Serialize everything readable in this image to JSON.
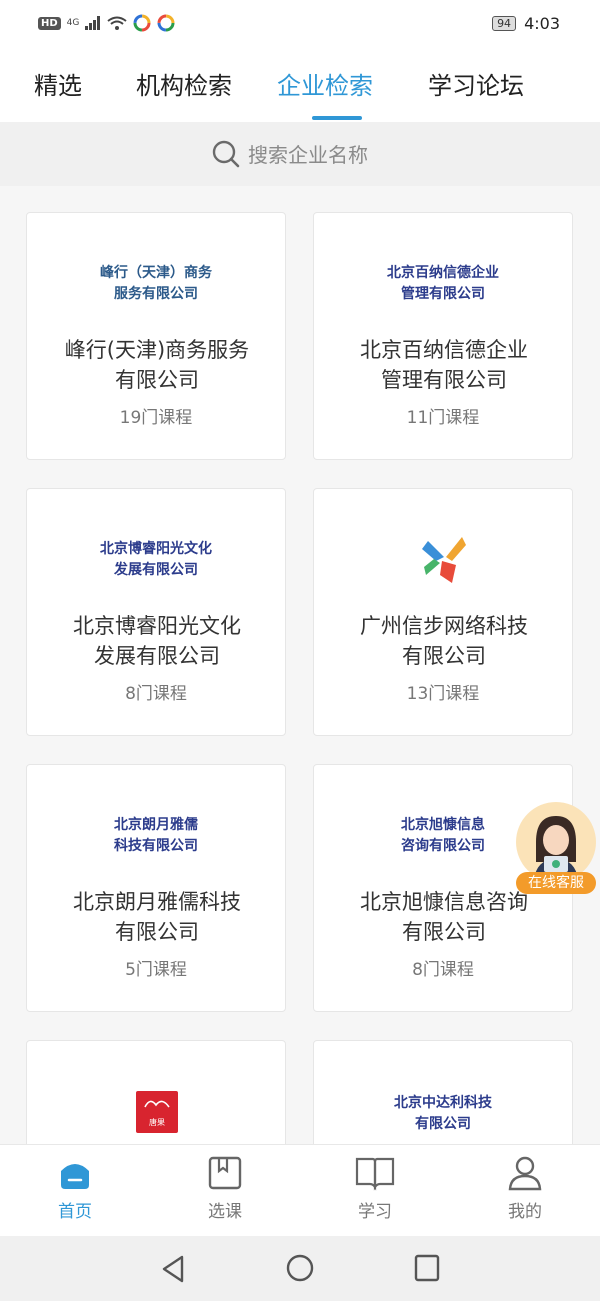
{
  "status_bar": {
    "left": "HD",
    "network": "4G",
    "battery": "94",
    "time": "4:03"
  },
  "tabs": [
    {
      "label": "精选"
    },
    {
      "label": "机构检索"
    },
    {
      "label": "企业检索"
    },
    {
      "label": "学习论坛"
    }
  ],
  "search": {
    "placeholder": "搜索企业名称"
  },
  "companies": [
    {
      "logo_line1": "峰行（天津）商务",
      "logo_line2": "服务有限公司",
      "name_line1": "峰行(天津)商务服务",
      "name_line2": "有限公司",
      "courses": "19门课程"
    },
    {
      "logo_line1": "北京百纳信德企业",
      "logo_line2": "管理有限公司",
      "name_line1": "北京百纳信德企业",
      "name_line2": "管理有限公司",
      "courses": "11门课程"
    },
    {
      "logo_line1": "北京博睿阳光文化",
      "logo_line2": "发展有限公司",
      "name_line1": "北京博睿阳光文化",
      "name_line2": "发展有限公司",
      "courses": "8门课程"
    },
    {
      "name_line1": "广州信步网络科技",
      "name_line2": "有限公司",
      "courses": "13门课程"
    },
    {
      "logo_line1": "北京朗月雅儒",
      "logo_line2": "科技有限公司",
      "name_line1": "北京朗月雅儒科技",
      "name_line2": "有限公司",
      "courses": "5门课程"
    },
    {
      "logo_line1": "北京旭慷信息",
      "logo_line2": "咨询有限公司",
      "name_line1": "北京旭慷信息咨询",
      "name_line2": "有限公司",
      "courses": "8门课程"
    },
    {
      "logo_text": "唐果"
    },
    {
      "logo_line1": "北京中达利科技",
      "logo_line2": "有限公司"
    }
  ],
  "customer_service": {
    "label": "在线客服"
  },
  "bottom_nav": [
    {
      "label": "首页",
      "icon": "home-icon"
    },
    {
      "label": "选课",
      "icon": "bookmark-icon"
    },
    {
      "label": "学习",
      "icon": "book-icon"
    },
    {
      "label": "我的",
      "icon": "user-icon"
    }
  ],
  "colors": {
    "accent": "#2f97d6",
    "logo_blue": "#2c3c8c",
    "cs_orange": "#f39b2a"
  }
}
